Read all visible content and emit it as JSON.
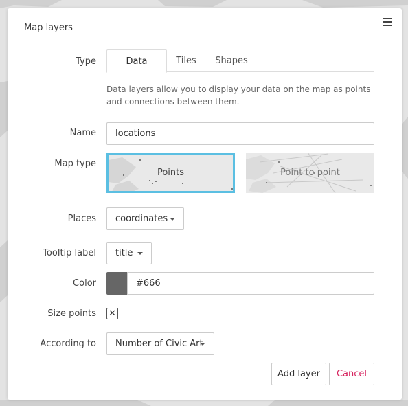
{
  "panel": {
    "title": "Map layers"
  },
  "labels": {
    "type": "Type",
    "name": "Name",
    "map_type": "Map type",
    "places": "Places",
    "tooltip_label": "Tooltip label",
    "color": "Color",
    "size_points": "Size points",
    "according_to": "According to"
  },
  "tabs": [
    {
      "label": "Data",
      "active": true
    },
    {
      "label": "Tiles",
      "active": false
    },
    {
      "label": "Shapes",
      "active": false
    }
  ],
  "help_text": "Data layers allow you to display your data on the map as points and connections between them.",
  "fields": {
    "name_value": "locations",
    "places_value": "coordinates",
    "tooltip_value": "title",
    "color_value": "#666",
    "size_points_checked": "✕",
    "according_to_value": "Number of Civic Art"
  },
  "map_types": [
    {
      "label": "Points",
      "selected": true
    },
    {
      "label": "Point to point",
      "selected": false
    }
  ],
  "buttons": {
    "add": "Add layer",
    "cancel": "Cancel"
  },
  "colors": {
    "selected_border": "#5bbfe2",
    "cancel_text": "#d6245f",
    "swatch": "#666666"
  }
}
